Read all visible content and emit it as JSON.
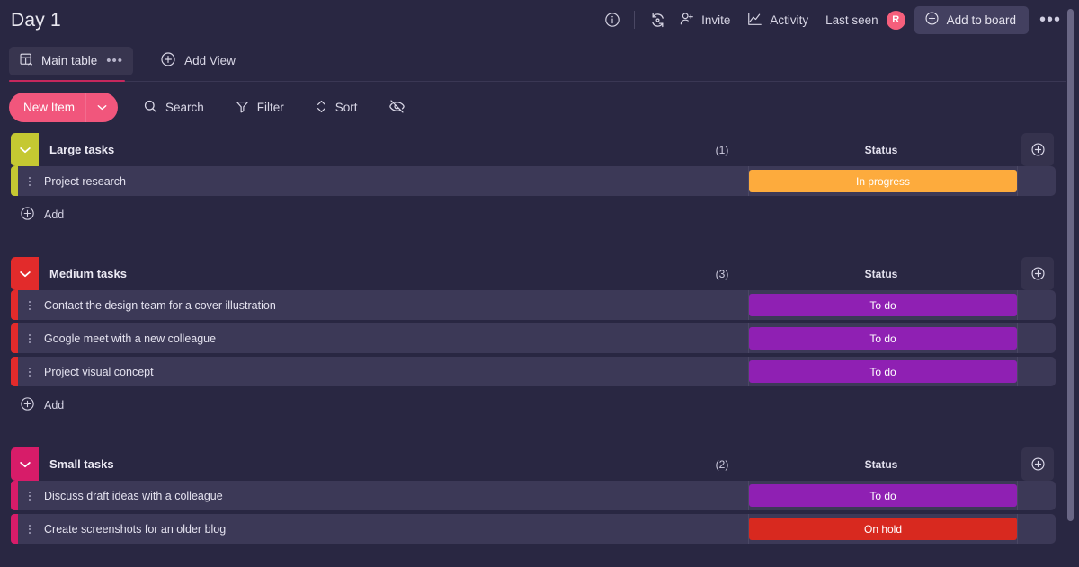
{
  "header": {
    "board_title": "Day 1",
    "info_icon": "info-circle-icon",
    "sync_icon": "sync-refresh-icon",
    "invite_label": "Invite",
    "invite_icon": "person-add-icon",
    "activity_label": "Activity",
    "activity_icon": "activity-chart-icon",
    "last_seen_label": "Last seen",
    "avatar_initial": "R",
    "avatar_color": "#f65f7c",
    "add_to_board_label": "Add to board",
    "add_to_board_icon": "plus-circle-icon",
    "more_options_icon": "ellipsis-icon"
  },
  "tabbar": {
    "tab_label": "Main table",
    "tab_icon": "table-home-icon",
    "tab_more_icon": "ellipsis-icon",
    "tab_accent": "#c5275c",
    "add_view_label": "Add View",
    "add_view_icon": "plus-circle-icon"
  },
  "toolbar": {
    "new_item_label": "New Item",
    "new_item_color": "#f1567c",
    "new_item_caret_icon": "chevron-down-icon",
    "search_label": "Search",
    "search_icon": "search-icon",
    "filter_label": "Filter",
    "filter_icon": "funnel-icon",
    "sort_label": "Sort",
    "sort_icon": "sort-arrows-icon",
    "hide_icon": "eye-off-icon"
  },
  "board": {
    "status_column_label": "Status",
    "add_label": "Add",
    "add_icon": "plus-circle-icon",
    "collapse_icon": "chevron-down-icon",
    "group_add_column_icon": "plus-circle-icon",
    "row_menu_icon": "vertical-dots-icon",
    "groups": [
      {
        "title": "Large tasks",
        "count": "(1)",
        "color": "#c5c832",
        "status_label": "Status",
        "add_label": "Add",
        "items": [
          {
            "name": "Project research",
            "status": "In progress",
            "status_color": "#fdab3d"
          }
        ]
      },
      {
        "title": "Medium tasks",
        "count": "(3)",
        "color": "#e22b2b",
        "status_label": "Status",
        "add_label": "Add",
        "items": [
          {
            "name": "Contact the design team for a cover illustration",
            "status": "To do",
            "status_color": "#8f20b3"
          },
          {
            "name": "Google meet with a new colleague",
            "status": "To do",
            "status_color": "#8f20b3"
          },
          {
            "name": "Project visual concept",
            "status": "To do",
            "status_color": "#8f20b3"
          }
        ]
      },
      {
        "title": "Small tasks",
        "count": "(2)",
        "color": "#d71c69",
        "status_label": "Status",
        "add_label": "Add",
        "items": [
          {
            "name": "Discuss draft ideas with a colleague",
            "status": "To do",
            "status_color": "#8f20b3"
          },
          {
            "name": "Create screenshots for an older blog",
            "status": "On hold",
            "status_color": "#d8291f"
          }
        ]
      }
    ]
  },
  "scrollbar": {
    "name": "vertical-scrollbar"
  }
}
